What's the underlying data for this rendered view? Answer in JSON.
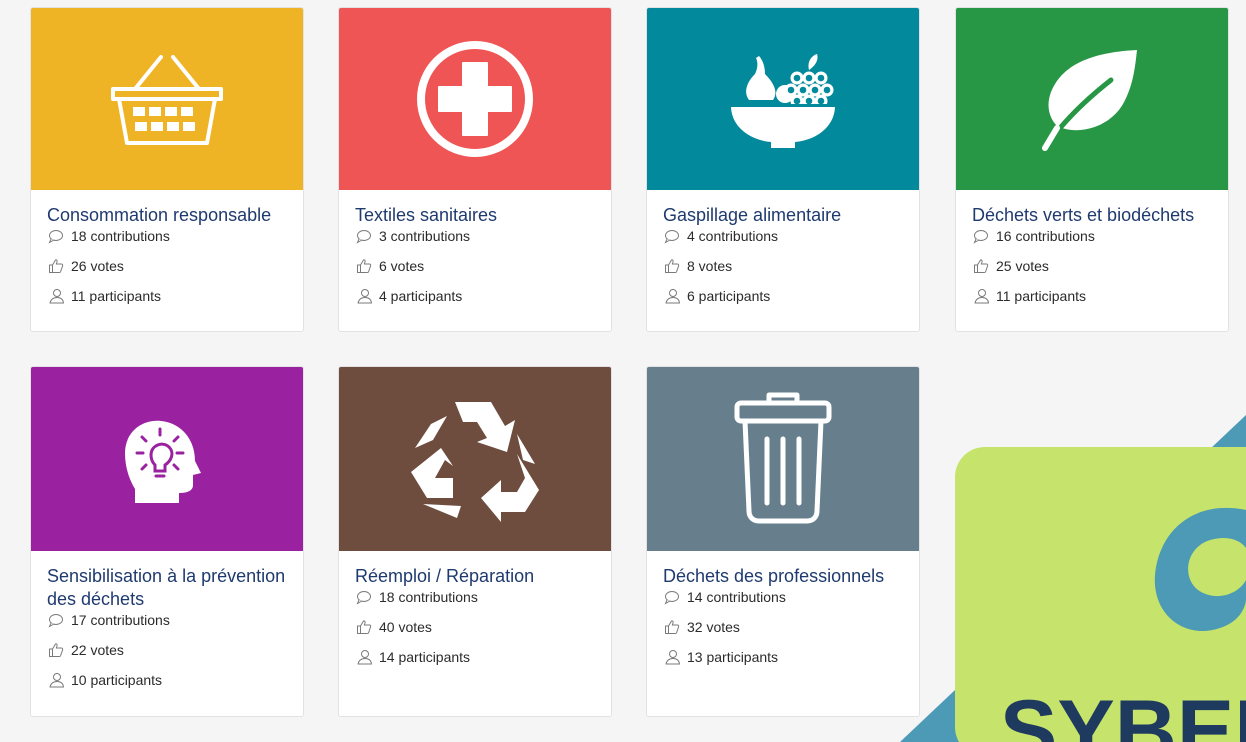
{
  "cards": [
    {
      "title": "Consommation responsable",
      "contributions": "18 contributions",
      "votes": "26 votes",
      "participants": "11 participants",
      "color": "#eeb426",
      "icon": "basket-icon"
    },
    {
      "title": "Textiles sanitaires",
      "contributions": "3 contributions",
      "votes": "6 votes",
      "participants": "4 participants",
      "color": "#f05555",
      "icon": "medical-cross-icon"
    },
    {
      "title": "Gaspillage alimentaire",
      "contributions": "4 contributions",
      "votes": "8 votes",
      "participants": "6 participants",
      "color": "#028a9c",
      "icon": "fruit-bowl-icon"
    },
    {
      "title": "Déchets verts et biodéchets",
      "contributions": "16 contributions",
      "votes": "25 votes",
      "participants": "11 participants",
      "color": "#289745",
      "icon": "leaf-icon"
    },
    {
      "title": "Sensibilisation à la prévention des déchets",
      "contributions": "17 contributions",
      "votes": "22 votes",
      "participants": "10 participants",
      "color": "#9a21a0",
      "icon": "head-lightbulb-icon"
    },
    {
      "title": "Réemploi / Réparation",
      "contributions": "18 contributions",
      "votes": "40 votes",
      "participants": "14 participants",
      "color": "#6e4c3e",
      "icon": "recycle-icon"
    },
    {
      "title": "Déchets des professionnels",
      "contributions": "14 contributions",
      "votes": "32 votes",
      "participants": "13 participants",
      "color": "#677f8d",
      "icon": "trash-can-icon"
    }
  ],
  "logo": {
    "text": "SYBERT",
    "bg_color": "#c6e46b",
    "accent_color": "#4c9ab5"
  }
}
